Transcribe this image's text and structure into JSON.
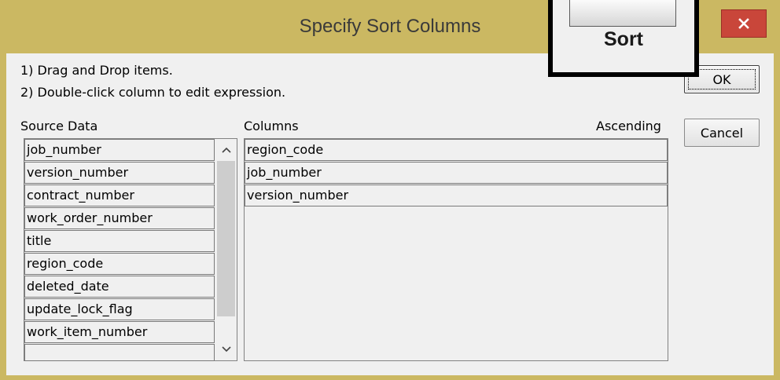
{
  "window": {
    "title": "Specify Sort Columns",
    "close_glyph": "×"
  },
  "instructions": {
    "line1": "1) Drag and Drop items.",
    "line2": "2) Double-click column to edit expression."
  },
  "source_data": {
    "label": "Source Data",
    "items": [
      "job_number",
      "version_number",
      "contract_number",
      "work_order_number",
      "title",
      "region_code",
      "deleted_date",
      "update_lock_flag",
      "work_item_number",
      ""
    ]
  },
  "columns": {
    "label": "Columns",
    "ascending_label": "Ascending",
    "items": [
      "region_code",
      "job_number",
      "version_number"
    ]
  },
  "buttons": {
    "ok": "OK",
    "cancel": "Cancel"
  },
  "callout": {
    "label": "Sort"
  },
  "icons": {
    "close": "close-icon",
    "scroll_up": "chevron-up-icon",
    "scroll_down": "chevron-down-icon"
  },
  "colors": {
    "title_bar": "#cbb862",
    "close_button": "#c9463a",
    "dialog_background": "#f0f0f0"
  }
}
